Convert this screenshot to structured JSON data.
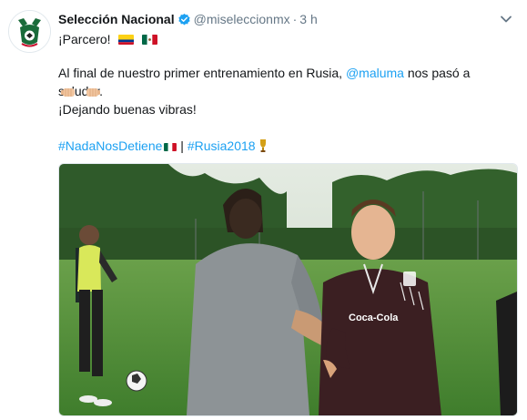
{
  "tweet": {
    "display_name": "Selección Nacional",
    "handle": "@miseleccionmx",
    "separator": "·",
    "time": "3 h",
    "line1": "¡Parcero!",
    "line2_before": "Al final de nuestro primer entrenamiento en Rusia, ",
    "line2_mention": "@maluma",
    "line2_after": " nos pasó a saludar.",
    "line4": "¡Dejando buenas vibras!",
    "hashtag1": "#NadaNosDetiene",
    "pipe": " | ",
    "hashtag2": "#Rusia2018"
  },
  "icons": {
    "avatar": "mexico-federation-crest",
    "verified": "verified-badge-icon",
    "menu": "chevron-down-icon",
    "flag1": "colombia-flag",
    "flag2": "mexico-flag",
    "fist": "fist-bump-emoji",
    "trophy": "trophy-emoji"
  },
  "colors": {
    "link": "#1da1f2",
    "text": "#14171a",
    "muted": "#657786"
  },
  "media": {
    "type": "photo",
    "description_visible": false
  }
}
